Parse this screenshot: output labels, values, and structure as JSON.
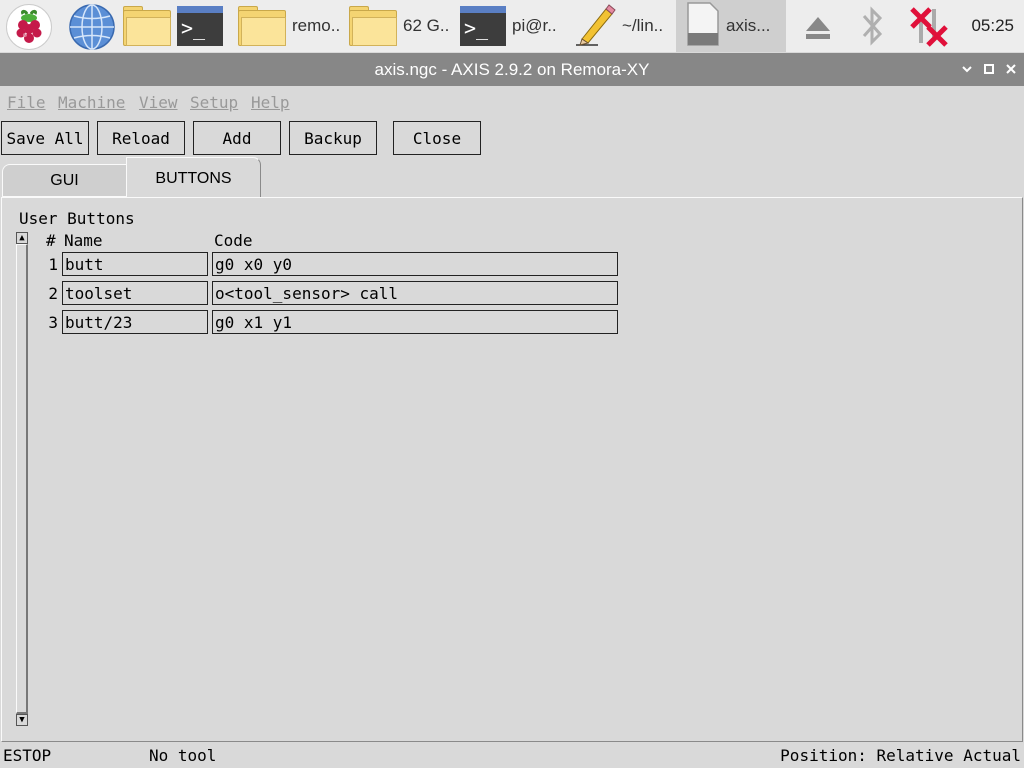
{
  "taskbar": {
    "items": [
      {
        "icon": "raspberry-pi-menu-icon"
      },
      {
        "icon": "web-browser-icon"
      },
      {
        "icon": "file-manager-icon"
      },
      {
        "icon": "terminal-icon"
      },
      {
        "icon": "folder-icon",
        "label": "remo.."
      },
      {
        "icon": "folder-icon",
        "label": "62 G.."
      },
      {
        "icon": "terminal-icon",
        "label": "pi@r.."
      },
      {
        "icon": "text-editor-icon",
        "label": "~/lin.."
      },
      {
        "icon": "document-icon",
        "label": "axis..."
      }
    ],
    "clock": "05:25"
  },
  "window": {
    "title": "axis.ngc - AXIS 2.9.2 on Remora-XY"
  },
  "menu": [
    "File",
    "Machine",
    "View",
    "Setup",
    "Help"
  ],
  "toolbar": {
    "save_all": "Save All",
    "reload": "Reload",
    "add": "Add",
    "backup": "Backup",
    "close": "Close"
  },
  "tabs": [
    {
      "label": "GUI",
      "active": false
    },
    {
      "label": "BUTTONS",
      "active": true
    }
  ],
  "user_buttons": {
    "heading": "User Buttons",
    "col_num": "#",
    "col_name": "Name",
    "col_code": "Code",
    "rows": [
      {
        "num": "1",
        "name": "butt",
        "code": "g0 x0 y0"
      },
      {
        "num": "2",
        "name": "toolset",
        "code": "o<tool_sensor> call"
      },
      {
        "num": "3",
        "name": "butt/23",
        "code": "g0 x1 y1"
      }
    ]
  },
  "status": {
    "estop": "ESTOP",
    "tool": "No tool",
    "position": "Position: Relative Actual"
  },
  "colors": {
    "taskbar_bg": "#ededed",
    "titlebar_bg": "#878787",
    "window_bg": "#d9d9d9",
    "disabled_text": "#999999",
    "bluetooth_disabled": "#b0b0b0",
    "network_error": "#e0103a"
  }
}
